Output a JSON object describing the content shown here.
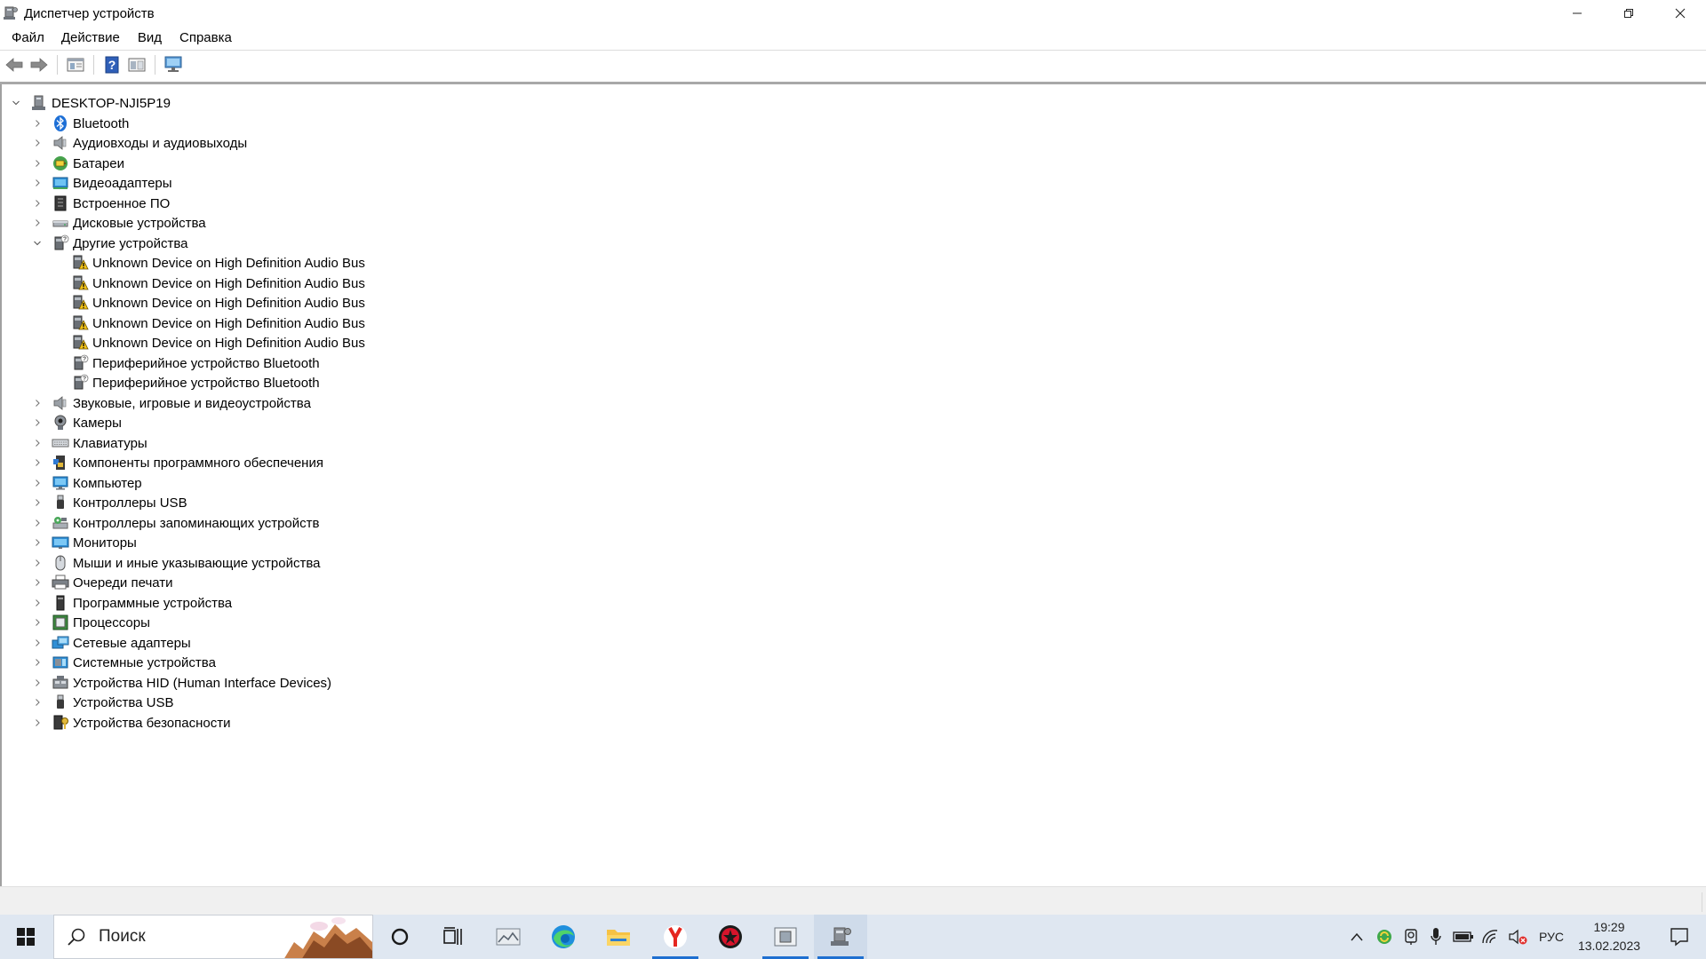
{
  "window": {
    "title": "Диспетчер устройств",
    "minimize_glyph": "—",
    "restore_glyph": "❐",
    "close_glyph": "✕"
  },
  "menu": {
    "items": [
      "Файл",
      "Действие",
      "Вид",
      "Справка"
    ]
  },
  "toolbar": {
    "buttons": [
      "back-icon",
      "forward-icon",
      "properties-icon",
      "help-icon",
      "update-driver-icon",
      "scan-hardware-icon"
    ]
  },
  "tree": {
    "root": "DESKTOP-NJI5P19",
    "categories": [
      {
        "label": "Bluetooth",
        "icon": "bluetooth-icon",
        "expanded": false
      },
      {
        "label": "Аудиовходы и аудиовыходы",
        "icon": "speaker-icon",
        "expanded": false
      },
      {
        "label": "Батареи",
        "icon": "battery-icon",
        "expanded": false
      },
      {
        "label": "Видеоадаптеры",
        "icon": "display-adapter-icon",
        "expanded": false
      },
      {
        "label": "Встроенное ПО",
        "icon": "firmware-icon",
        "expanded": false
      },
      {
        "label": "Дисковые устройства",
        "icon": "disk-icon",
        "expanded": false
      },
      {
        "label": "Другие устройства",
        "icon": "unknown-device-icon",
        "expanded": true,
        "children": [
          {
            "label": "Unknown Device on High Definition Audio Bus",
            "icon": "warning-device-icon"
          },
          {
            "label": "Unknown Device on High Definition Audio Bus",
            "icon": "warning-device-icon"
          },
          {
            "label": "Unknown Device on High Definition Audio Bus",
            "icon": "warning-device-icon"
          },
          {
            "label": "Unknown Device on High Definition Audio Bus",
            "icon": "warning-device-icon"
          },
          {
            "label": "Unknown Device on High Definition Audio Bus",
            "icon": "warning-device-icon"
          },
          {
            "label": "Периферийное устройство Bluetooth",
            "icon": "unknown-device-icon"
          },
          {
            "label": "Периферийное устройство Bluetooth",
            "icon": "unknown-device-icon"
          }
        ]
      },
      {
        "label": "Звуковые, игровые и видеоустройства",
        "icon": "speaker-icon",
        "expanded": false
      },
      {
        "label": "Камеры",
        "icon": "camera-icon",
        "expanded": false
      },
      {
        "label": "Клавиатуры",
        "icon": "keyboard-icon",
        "expanded": false
      },
      {
        "label": "Компоненты программного обеспечения",
        "icon": "software-component-icon",
        "expanded": false
      },
      {
        "label": "Компьютер",
        "icon": "computer-icon",
        "expanded": false
      },
      {
        "label": "Контроллеры USB",
        "icon": "usb-icon",
        "expanded": false
      },
      {
        "label": "Контроллеры запоминающих устройств",
        "icon": "storage-controller-icon",
        "expanded": false
      },
      {
        "label": "Мониторы",
        "icon": "monitor-icon",
        "expanded": false
      },
      {
        "label": "Мыши и иные указывающие устройства",
        "icon": "mouse-icon",
        "expanded": false
      },
      {
        "label": "Очереди печати",
        "icon": "printer-icon",
        "expanded": false
      },
      {
        "label": "Программные устройства",
        "icon": "software-device-icon",
        "expanded": false
      },
      {
        "label": "Процессоры",
        "icon": "processor-icon",
        "expanded": false
      },
      {
        "label": "Сетевые адаптеры",
        "icon": "network-adapter-icon",
        "expanded": false
      },
      {
        "label": "Системные устройства",
        "icon": "system-device-icon",
        "expanded": false
      },
      {
        "label": "Устройства HID (Human Interface Devices)",
        "icon": "hid-icon",
        "expanded": false
      },
      {
        "label": "Устройства USB",
        "icon": "usb-icon",
        "expanded": false
      },
      {
        "label": "Устройства безопасности",
        "icon": "security-device-icon",
        "expanded": false
      }
    ]
  },
  "taskbar": {
    "search_placeholder": "Поиск",
    "apps": [
      "cortana-icon",
      "task-view-icon",
      "photos-icon",
      "edge-icon",
      "file-explorer-icon",
      "yandex-browser-icon",
      "red-app-icon",
      "system-app-icon",
      "device-manager-icon"
    ],
    "tray": {
      "language": "РУС",
      "time": "19:29",
      "date": "13.02.2023"
    }
  },
  "colors": {
    "taskbar_bg": "#dfe7f1",
    "accent": "#1e6fd0",
    "window_bg": "#ffffff",
    "statusbar_bg": "#f0f0f0"
  }
}
